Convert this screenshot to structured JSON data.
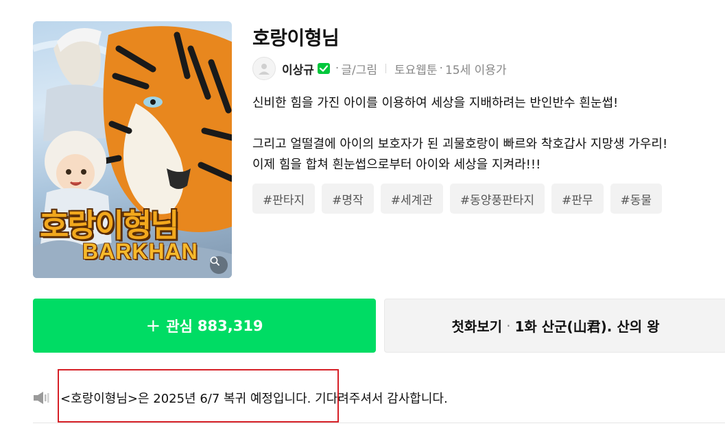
{
  "cover": {
    "title_kr": "호랑이형님",
    "title_en": "BARKHAN",
    "zoom_icon": "search-icon"
  },
  "title": "호랑이형님",
  "meta": {
    "author": "이상규",
    "verified_icon": "verified-check-icon",
    "role": "글/그림",
    "day": "토요웹툰",
    "age_rating": "15세 이용가",
    "separator": "·"
  },
  "description": {
    "line1": "신비한 힘을 가진 아이를 이용하여 세상을 지배하려는 반인반수 흰눈썹!",
    "line2": "그리고 얼떨결에 아이의 보호자가 된 괴물호랑이 빠르와 착호갑사 지망생 가우리!",
    "line3": "이제 힘을 합쳐 흰눈썹으로부터 아이와 세상을 지켜라!!!"
  },
  "tags": [
    "#판타지",
    "#명작",
    "#세계관",
    "#동양풍판타지",
    "#판무",
    "#동물"
  ],
  "favorite_button": {
    "icon": "+",
    "label": "관심",
    "count": "883,319"
  },
  "first_episode_button": {
    "label": "첫화보기",
    "separator": "·",
    "episode": "1화 산군(山君). 산의 왕"
  },
  "notice": {
    "icon": "speaker-icon",
    "text": "<호랑이형님>은 2025년 6/7 복귀 예정입니다. 기다려주셔서 감사합니다."
  },
  "colors": {
    "accent_green": "#00dc64",
    "highlight_red": "#d61f26",
    "tag_bg": "#f2f2f2"
  }
}
